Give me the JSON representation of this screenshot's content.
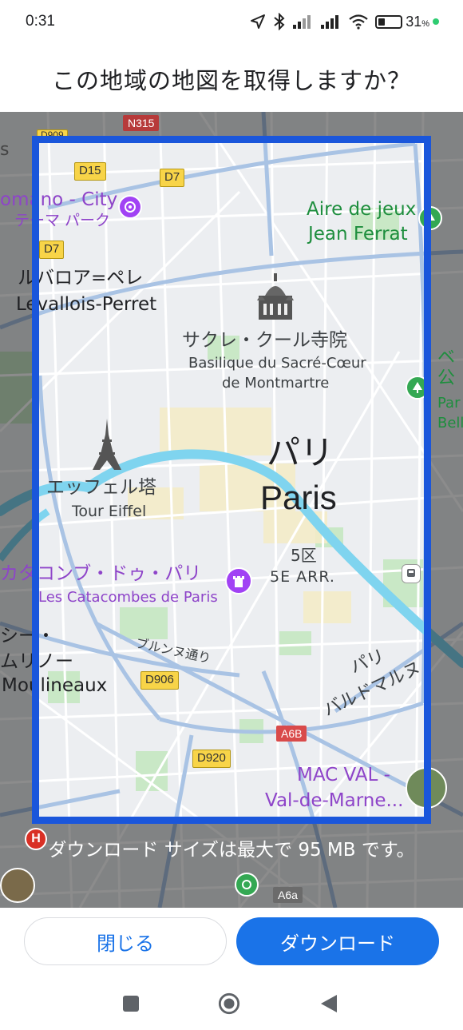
{
  "status_bar": {
    "time": "0:31",
    "battery_percent": "31",
    "battery_unit": "%",
    "battery_level": 0.31
  },
  "header": {
    "title": "この地域の地図を取得しますか？"
  },
  "map": {
    "labels": {
      "city_jp": "パリ",
      "city_en": "Paris",
      "sacre_coeur_jp": "サクレ・クール寺院",
      "sacre_coeur_fr_1": "Basilique du Sacré-Cœur",
      "sacre_coeur_fr_2": "de Montmartre",
      "eiffel_jp": "エッフェル塔",
      "eiffel_fr": "Tour Eiffel",
      "catacombs_jp": "カタコンブ・ドゥ・パリ",
      "catacombs_fr": "Les Catacombes de Paris",
      "arr5_jp": "5区",
      "arr5_fr": "5E ARR.",
      "levallois_jp": "ルバロア=ペレ",
      "levallois_fr": "Levallois-Perret",
      "romano_1": "omano - City",
      "romano_2": "テーマ パーク",
      "aire_1": "Aire de jeux",
      "aire_2": "Jean Ferrat",
      "belle_1": "ベ",
      "belle_2": "公",
      "belle_3": "Par",
      "belle_4": "Bell",
      "moulineaux_1": "シー・",
      "moulineaux_2": "ムリノー",
      "moulineaux_3": "Moulineaux",
      "brune_street": "ブルンヌ通り",
      "bd_1": "パリ",
      "bd_2": "バルドマルヌ",
      "mac_val_1": "MAC VAL -",
      "mac_val_2": "Val-de-Marne...",
      "left_edge": "s"
    },
    "road_shields": {
      "n315": "N315",
      "d15": "D15",
      "d7_a": "D7",
      "d7_b": "D7",
      "d906": "D906",
      "d920": "D920",
      "a6b": "A6B",
      "a6a": "A6a",
      "d909": "D909"
    },
    "colors": {
      "selection_frame": "#1a56db",
      "water": "#7dd3ee",
      "park": "#c6e9c4",
      "road": "#ffffff",
      "major_road": "#a8c4e6",
      "poi_purple": "#a142f4",
      "poi_green": "#34a853"
    }
  },
  "download_note": "ダウンロード サイズは最大で 95 MB です。",
  "buttons": {
    "close": "閉じる",
    "download": "ダウンロード"
  },
  "icons": {
    "location": "navigation-arrow-icon",
    "bluetooth": "bluetooth-icon",
    "signal": "cellular-signal-icon",
    "wifi": "wifi-icon",
    "battery": "battery-icon"
  }
}
